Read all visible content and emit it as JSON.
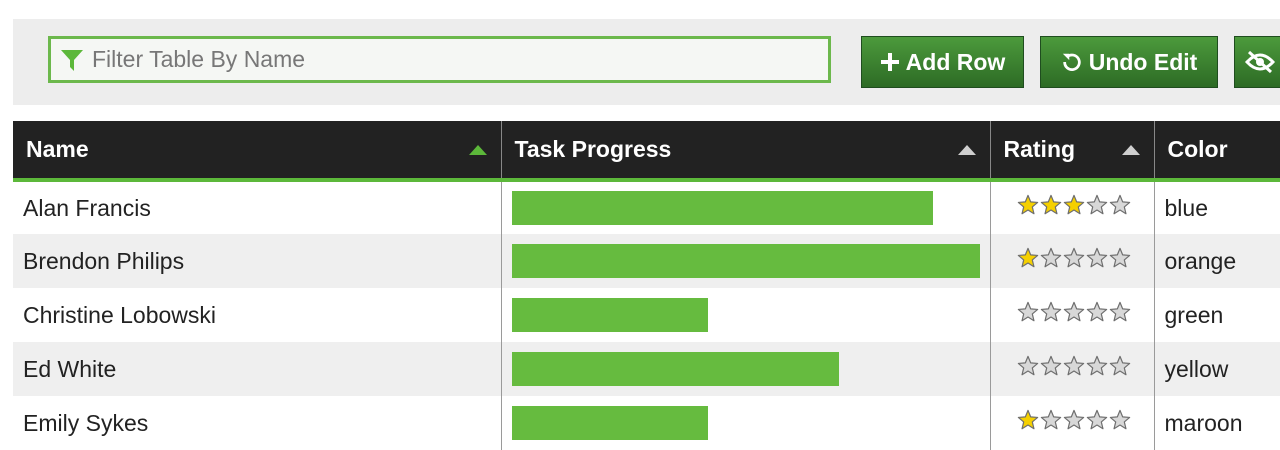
{
  "toolbar": {
    "filter_placeholder": "Filter Table By Name",
    "add_row_label": "Add Row",
    "undo_edit_label": "Undo Edit"
  },
  "table": {
    "columns": [
      "Name",
      "Task Progress",
      "Rating",
      "Color"
    ],
    "sort": {
      "active_column": "Name",
      "active_color": "#5cb83a",
      "inactive_color": "#cfcfcf"
    },
    "rows": [
      {
        "name": "Alan Francis",
        "progress": 0.9,
        "rating": 3,
        "color": "blue"
      },
      {
        "name": "Brendon Philips",
        "progress": 1.0,
        "rating": 1,
        "color": "orange"
      },
      {
        "name": "Christine Lobowski",
        "progress": 0.42,
        "rating": 0,
        "color": "green"
      },
      {
        "name": "Ed White",
        "progress": 0.7,
        "rating": 0,
        "color": "yellow"
      },
      {
        "name": "Emily Sykes",
        "progress": 0.42,
        "rating": 1,
        "color": "maroon"
      }
    ],
    "max_rating": 5
  },
  "colors": {
    "accent": "#5cb83a",
    "bar": "#66bb3f",
    "header_bg": "#222222",
    "star_filled": "#f5d000",
    "star_empty": "#d8d8d8"
  },
  "icons": [
    "filter-icon",
    "plus-icon",
    "undo-icon",
    "eye-slash-icon",
    "star-icon"
  ]
}
